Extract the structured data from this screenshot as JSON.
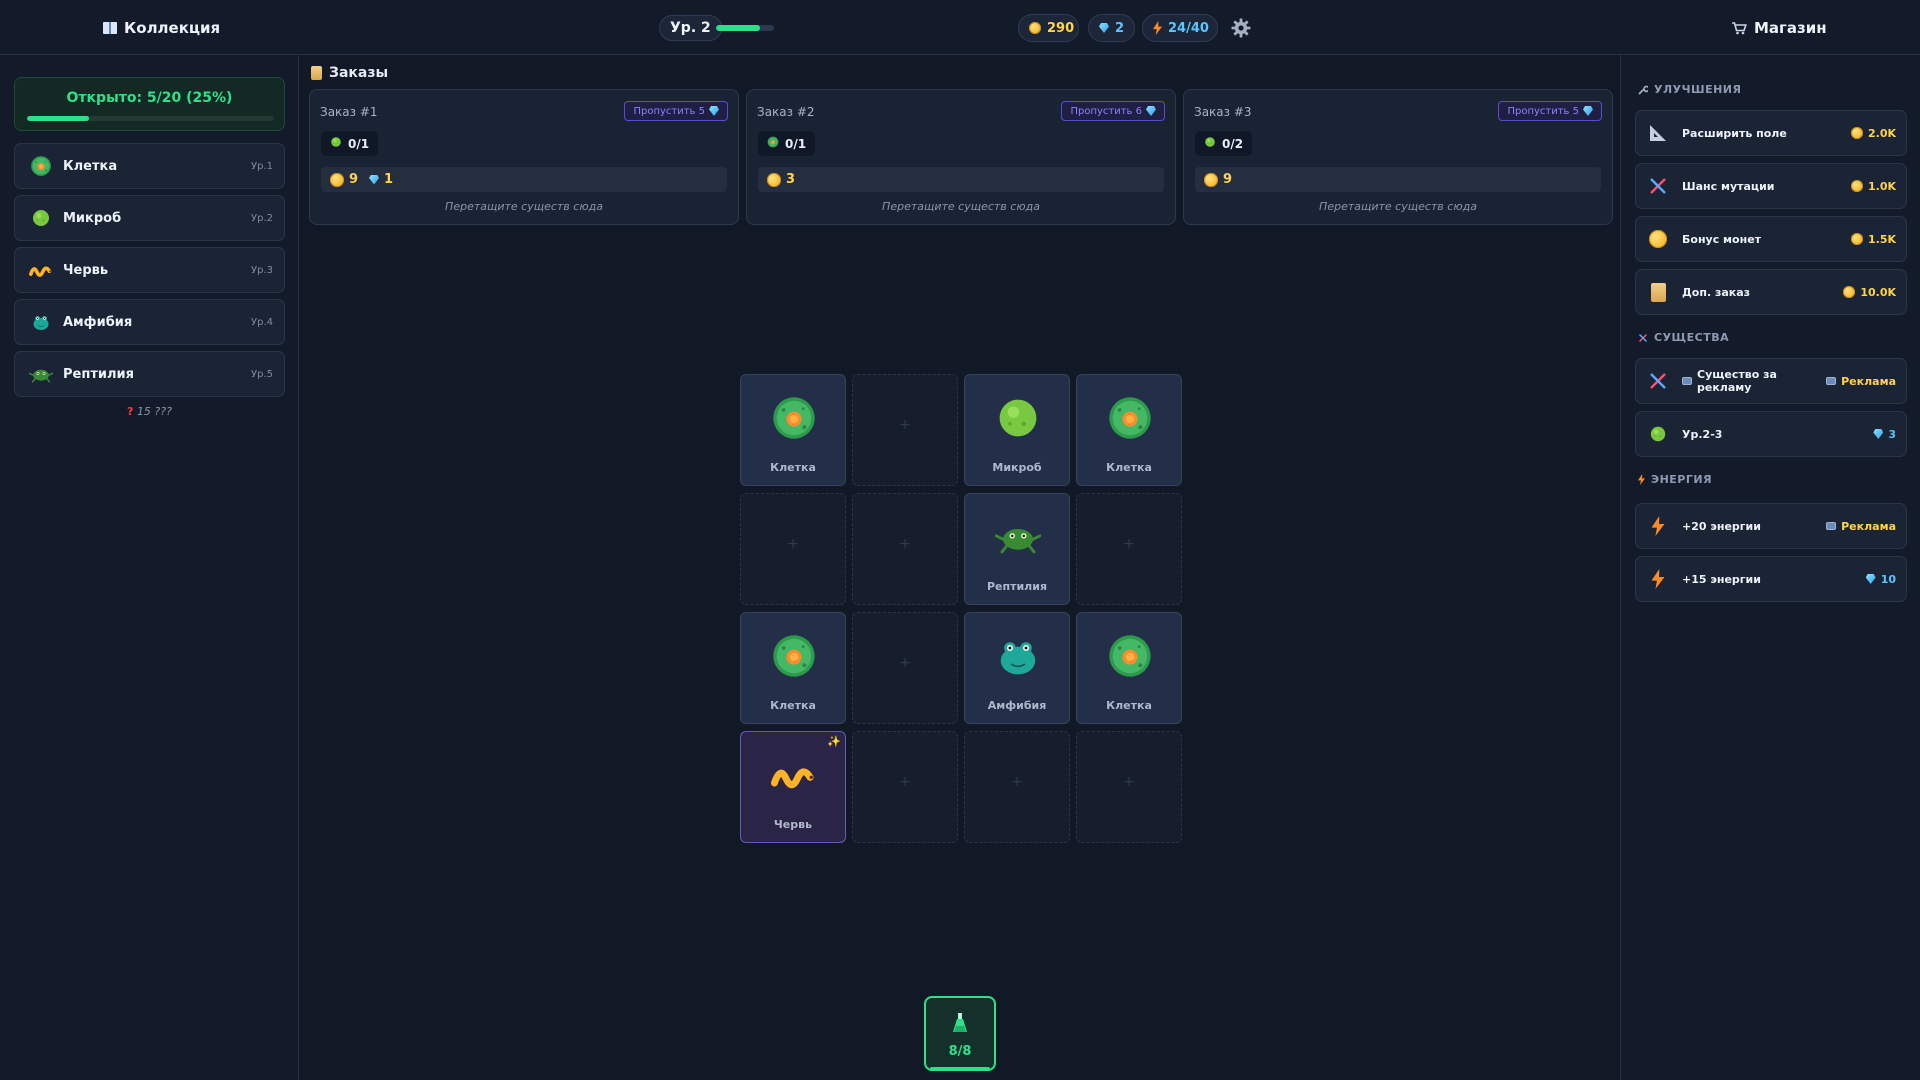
{
  "topbar": {
    "collection_label": "Коллекция",
    "level_label": "Ур. 2",
    "xp_progress": 0.75,
    "coins": "290",
    "gems": "2",
    "energy": "24/40",
    "shop_label": "Магазин"
  },
  "collection": {
    "progress_text": "Открыто: 5/20 (25%)",
    "progress": 0.25,
    "items": [
      {
        "name": "Клетка",
        "level": "Ур.1",
        "icon": "cell-icon"
      },
      {
        "name": "Микроб",
        "level": "Ур.2",
        "icon": "microbe-icon"
      },
      {
        "name": "Червь",
        "level": "Ур.3",
        "icon": "worm-icon"
      },
      {
        "name": "Амфибия",
        "level": "Ур.4",
        "icon": "amphibian-icon"
      },
      {
        "name": "Рептилия",
        "level": "Ур.5",
        "icon": "reptile-icon"
      }
    ],
    "unknown_mark": "?",
    "unknown_text": "15 ???"
  },
  "orders": {
    "title": "Заказы",
    "hint": "Перетащите существ сюда",
    "list": [
      {
        "name": "Заказ #1",
        "skip": "Пропустить 5",
        "req": "0/1",
        "req_icon": "microbe-icon",
        "reward_coins": "9",
        "reward_gems": "1"
      },
      {
        "name": "Заказ #2",
        "skip": "Пропустить 6",
        "req": "0/1",
        "req_icon": "cell-icon",
        "reward_coins": "3",
        "reward_gems": ""
      },
      {
        "name": "Заказ #3",
        "skip": "Пропустить 5",
        "req": "0/2",
        "req_icon": "microbe-icon",
        "reward_coins": "9",
        "reward_gems": ""
      }
    ]
  },
  "grid": {
    "empty_symbol": "+",
    "cells": [
      {
        "label": "Клетка",
        "icon": "cell-icon"
      },
      {
        "label": "",
        "icon": ""
      },
      {
        "label": "Микроб",
        "icon": "microbe-icon"
      },
      {
        "label": "Клетка",
        "icon": "cell-icon"
      },
      {
        "label": "",
        "icon": ""
      },
      {
        "label": "",
        "icon": ""
      },
      {
        "label": "Рептилия",
        "icon": "reptile-icon"
      },
      {
        "label": "",
        "icon": ""
      },
      {
        "label": "Клетка",
        "icon": "cell-icon"
      },
      {
        "label": "",
        "icon": ""
      },
      {
        "label": "Амфибия",
        "icon": "amphibian-icon"
      },
      {
        "label": "Клетка",
        "icon": "cell-icon"
      },
      {
        "label": "Червь",
        "icon": "worm-icon",
        "special": true,
        "sparkle": "✨"
      },
      {
        "label": "",
        "icon": ""
      },
      {
        "label": "",
        "icon": ""
      },
      {
        "label": "",
        "icon": ""
      }
    ]
  },
  "spawner": {
    "count": "8/8",
    "fill": 1.0
  },
  "shop": {
    "upgrades_title": "УЛУЧШЕНИЯ",
    "upgrades": [
      {
        "name": "Расширить поле",
        "price": "2.0K",
        "icon": "ruler-icon"
      },
      {
        "name": "Шанс мутации",
        "price": "1.0K",
        "icon": "dna-icon"
      },
      {
        "name": "Бонус монет",
        "price": "1.5K",
        "icon": "coin-icon"
      },
      {
        "name": "Доп. заказ",
        "price": "10.0K",
        "icon": "scroll-icon"
      }
    ],
    "creatures_title": "СУЩЕСТВА",
    "creatures": [
      {
        "name": "Существо за рекламу",
        "price": "Реклама",
        "icon": "dna-icon",
        "price_type": "ad"
      },
      {
        "name": "Ур.2-3",
        "price": "3",
        "icon": "microbe-icon",
        "price_type": "gem"
      }
    ],
    "energy_title": "ЭНЕРГИЯ",
    "energy": [
      {
        "name": "+20 энергии",
        "price": "Реклама",
        "icon": "bolt-icon",
        "price_type": "ad"
      },
      {
        "name": "+15 энергии",
        "price": "10",
        "icon": "bolt-icon",
        "price_type": "gem"
      }
    ]
  },
  "colors": {
    "accent_green": "#2fe08a",
    "coin": "#ffd34a",
    "gem": "#58c6ff",
    "skip": "#8f80ff"
  }
}
